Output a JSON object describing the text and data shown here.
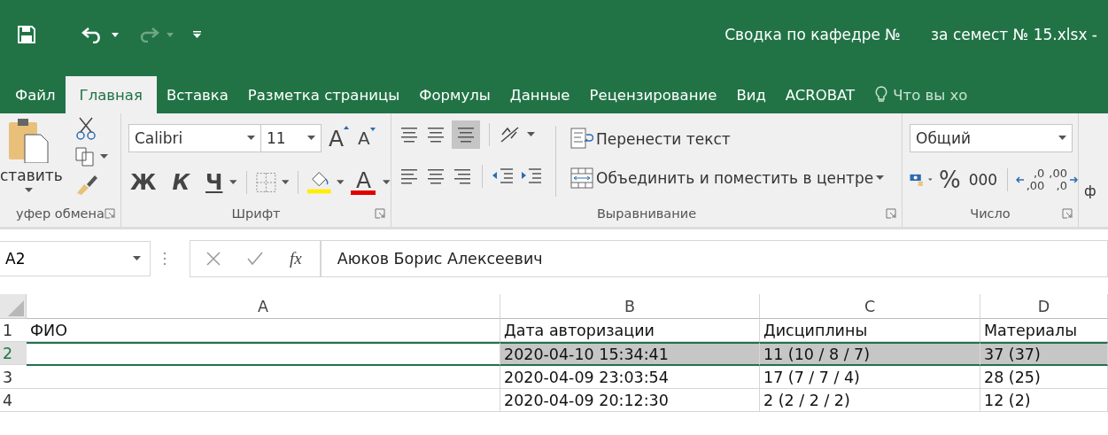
{
  "window": {
    "title_parts": [
      "Сводка по кафедре №",
      "за семест № 15.xlsx -"
    ]
  },
  "ribbon_tabs": [
    {
      "label": "Файл",
      "selected": false
    },
    {
      "label": "Главная",
      "selected": true
    },
    {
      "label": "Вставка",
      "selected": false
    },
    {
      "label": "Разметка страницы",
      "selected": false
    },
    {
      "label": "Формулы",
      "selected": false
    },
    {
      "label": "Данные",
      "selected": false
    },
    {
      "label": "Рецензирование",
      "selected": false
    },
    {
      "label": "Вид",
      "selected": false
    },
    {
      "label": "ACROBAT",
      "selected": false
    }
  ],
  "tell_me": {
    "placeholder": "Что вы хо"
  },
  "ribbon": {
    "clipboard": {
      "paste_label": "ставить",
      "group_label": "уфер обмена"
    },
    "font": {
      "font_name": "Calibri",
      "font_size": "11",
      "grow": "A",
      "shrink": "A",
      "bold": "Ж",
      "italic": "К",
      "underline": "Ч",
      "font_color": "A",
      "group_label": "Шрифт"
    },
    "alignment": {
      "bottom_align_selected": true,
      "wrap_text": "Перенести текст",
      "merge": "Объединить и поместить в центре",
      "group_label": "Выравнивание"
    },
    "number": {
      "format": "Общий",
      "percent": "%",
      "thousands": "000",
      "increase_decimal": [
        ",0",
        ",00"
      ],
      "decrease_decimal": [
        ",00",
        ",0"
      ],
      "group_label": "Число"
    },
    "next_group_cut": "ф"
  },
  "formula_bar": {
    "name_box": "A2",
    "function_label": "fx",
    "value": "Аюков Борис Алексеевич"
  },
  "grid": {
    "columns": [
      {
        "label": "A"
      },
      {
        "label": "B"
      },
      {
        "label": "C"
      },
      {
        "label": "D"
      }
    ],
    "rows": [
      {
        "header": "1",
        "selected": false,
        "cells": {
          "A": "ФИО",
          "B": "Дата авторизации",
          "C": "Дисциплины",
          "D": "Материалы"
        }
      },
      {
        "header": "2",
        "selected": true,
        "cells": {
          "B": "2020-04-10 15:34:41",
          "C": "11 (10 / 8 / 7)",
          "D": "37 (37)"
        }
      },
      {
        "header": "3",
        "selected": false,
        "cells": {
          "B": "2020-04-09 23:03:54",
          "C": "17 (7 / 7 / 4)",
          "D": "28 (25)"
        }
      },
      {
        "header": "4",
        "selected": false,
        "cells": {
          "B": "2020-04-09 20:12:30",
          "C": "2 (2 / 2 / 2)",
          "D": "12 (2)"
        }
      }
    ]
  }
}
